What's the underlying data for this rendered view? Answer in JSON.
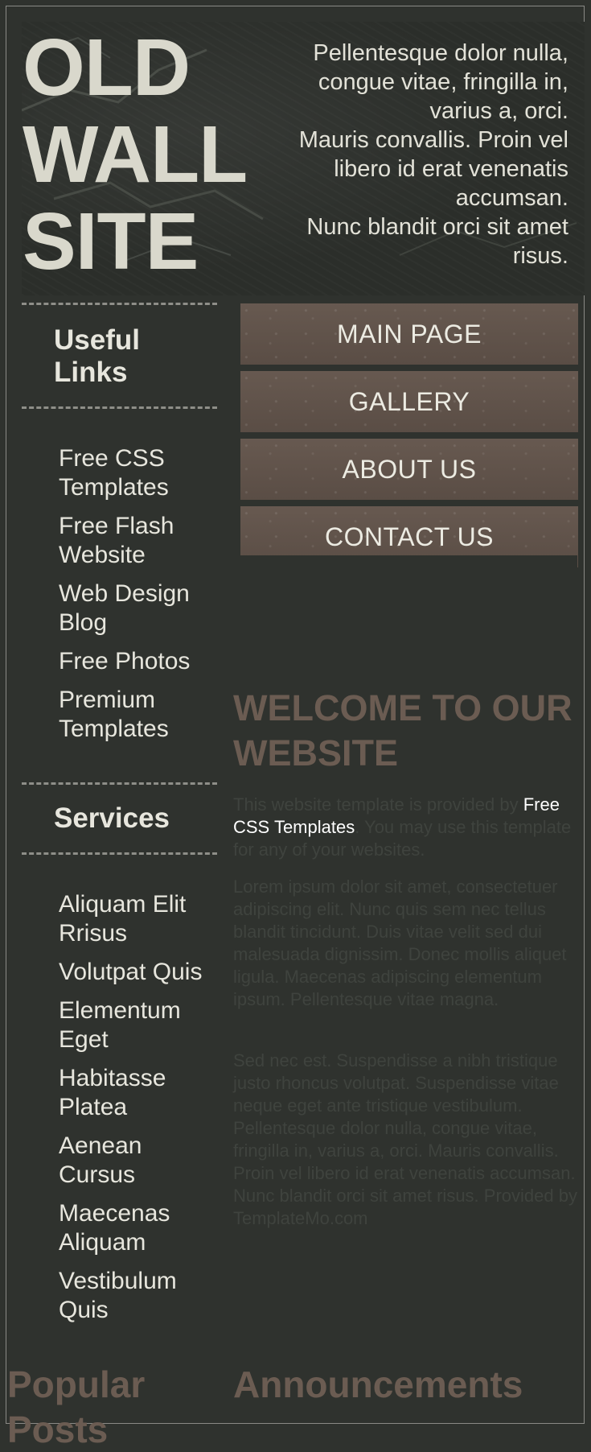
{
  "header": {
    "title_lines": [
      "OLD",
      "WALL",
      "SITE"
    ],
    "tagline": [
      "Pellentesque dolor nulla, congue vitae, fringilla in, varius a, orci.",
      "Mauris convallis. Proin vel libero id erat venenatis accumsan.",
      "Nunc blandit orci sit amet risus."
    ]
  },
  "sidebar": {
    "useful_links": {
      "heading": "Useful Links",
      "items": [
        "Free CSS Templates",
        "Free Flash Website",
        "Web Design Blog",
        "Free Photos",
        "Premium Templates"
      ]
    },
    "services": {
      "heading": "Services",
      "items": [
        "Aliquam Elit Rrisus",
        "Volutpat Quis",
        "Elementum Eget",
        "Habitasse Platea",
        "Aenean Cursus",
        "Maecenas Aliquam",
        "Vestibulum Quis"
      ]
    }
  },
  "nav": {
    "items": [
      "MAIN PAGE",
      "GALLERY",
      "ABOUT US",
      "CONTACT US"
    ]
  },
  "main": {
    "heading": "WELCOME TO OUR WEBSITE",
    "intro_before": "This website template is provided by ",
    "intro_link": "Free CSS Templates",
    "intro_after": ". You may use this template for any of your websites.",
    "para2": "Lorem ipsum dolor sit amet, consectetuer adipiscing elit. Nunc quis sem nec tellus blandit tincidunt. Duis vitae velit sed dui malesuada dignissim. Donec mollis aliquet ligula. Maecenas adipiscing elementum ipsum. Pellentesque vitae magna.",
    "para3": "Sed nec est. Suspendisse a nibh tristique justo rhoncus volutpat. Suspendisse vitae neque eget ante tristique vestibulum. Pellentesque dolor nulla, congue vitae, fringilla in, varius a, orci. Mauris convallis. Proin vel libero id erat venenatis accumsan. Nunc blandit orci sit amet risus. Provided by TemplateMo.com"
  },
  "footer": {
    "popular_posts": "Popular Posts",
    "announcements": "Announcements"
  },
  "colors": {
    "background": "#2f322e",
    "title": "#d9d8cc",
    "nav_button": "#5f524a",
    "accent_heading": "#6b5c52"
  }
}
